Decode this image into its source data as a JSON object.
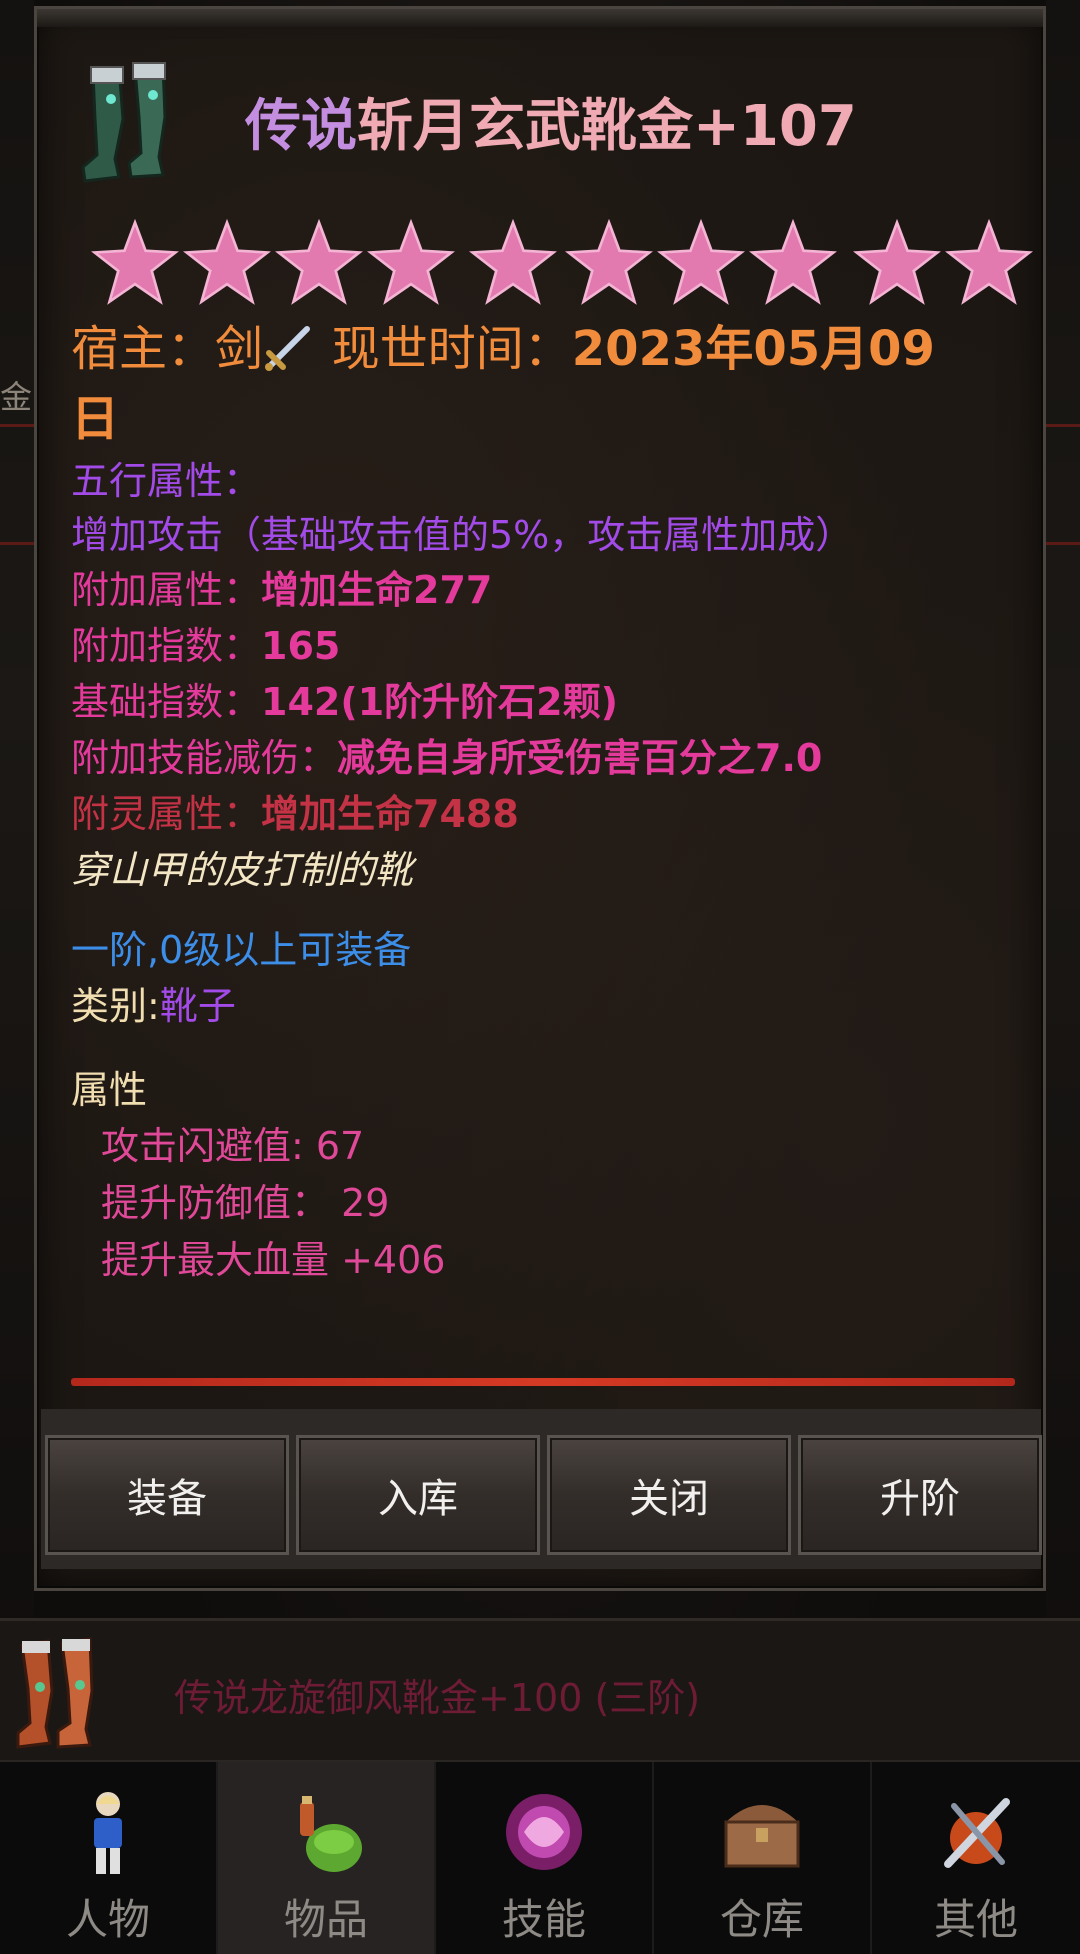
{
  "item": {
    "title_prefix": "传说",
    "title_main": "斩月玄武靴金+107",
    "stars": 10,
    "star_color": "#e27ab0",
    "owner_label": "宿主：",
    "owner_name": "剑",
    "time_label": "现世时间：",
    "time_value": "2023年05月09",
    "time_value_wrap": "日",
    "five_elements_label": "五行属性：",
    "five_elements_value": "增加攻击（基础攻击值的5%，攻击属性加成）",
    "extra_attr_label": "附加属性：",
    "extra_attr_value": "增加生命277",
    "extra_index_label": "附加指数：",
    "extra_index_value": "165",
    "base_index_label": "基础指数：",
    "base_index_value": "142(1阶升阶石2颗)",
    "skill_reduce_label": "附加技能减伤：",
    "skill_reduce_value": "减免自身所受伤害百分之7.0",
    "spirit_attr_label": "附灵属性：",
    "spirit_attr_value": "增加生命7488",
    "description": "穿山甲的皮打制的靴",
    "requirement": "一阶,0级以上可装备",
    "category_label": "类别:",
    "category_value": "靴子",
    "attributes_title": "属性",
    "attributes": [
      "攻击闪避值: 67",
      "提升防御值： 29",
      "提升最大血量 +406"
    ]
  },
  "buttons": {
    "equip": "装备",
    "store": "入库",
    "close": "关闭",
    "upgrade": "升阶"
  },
  "list_item": {
    "label": "传说龙旋御风靴金+100 (三阶)"
  },
  "background_edge_text": "金",
  "nav": {
    "active": "物品",
    "items": [
      "人物",
      "物品",
      "技能",
      "仓库",
      "其他"
    ]
  },
  "colors": {
    "title_prefix": "#c48ee0",
    "title_main": "#f0aab4",
    "owner": "#f08c3c",
    "five_elements": "#a24be8",
    "extra": "#e43a9c",
    "spirit": "#c43246",
    "requirement": "#3c8ee8",
    "divider": "#d53a24"
  }
}
